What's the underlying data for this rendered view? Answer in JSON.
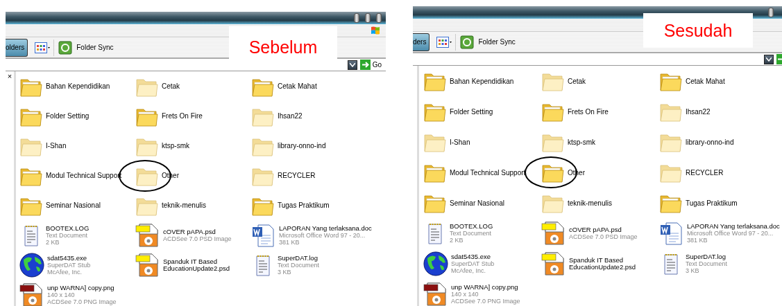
{
  "panels": [
    {
      "label": "Sebelum",
      "folders_button": "olders",
      "sync_button": "Folder Sync",
      "go_button": "Go",
      "close_mark": "×",
      "items": [
        {
          "kind": "folder",
          "name": "Bahan Kependidikan",
          "filled": true,
          "circled": false
        },
        {
          "kind": "folder",
          "name": "Cetak",
          "filled": false,
          "circled": false
        },
        {
          "kind": "folder",
          "name": "Cetak Mahat",
          "filled": true,
          "circled": false
        },
        {
          "kind": "folder",
          "name": "Folder Setting",
          "filled": true,
          "circled": false
        },
        {
          "kind": "folder",
          "name": "Frets On Fire",
          "filled": true,
          "circled": false
        },
        {
          "kind": "folder",
          "name": "Ihsan22",
          "filled": false,
          "circled": false
        },
        {
          "kind": "folder",
          "name": "I-Shan",
          "filled": false,
          "circled": false
        },
        {
          "kind": "folder",
          "name": "ktsp-smk",
          "filled": false,
          "circled": false
        },
        {
          "kind": "folder",
          "name": "library-onno-ind",
          "filled": false,
          "circled": false
        },
        {
          "kind": "folder",
          "name": "Modul Technical Support",
          "filled": true,
          "circled": false
        },
        {
          "kind": "folder",
          "name": "Other",
          "filled": false,
          "circled": true
        },
        {
          "kind": "folder",
          "name": "RECYCLER",
          "filled": false,
          "circled": false
        },
        {
          "kind": "folder",
          "name": "Seminar Nasional",
          "filled": true,
          "circled": false
        },
        {
          "kind": "folder",
          "name": "teknik-menulis",
          "filled": false,
          "circled": false
        },
        {
          "kind": "folder",
          "name": "Tugas Praktikum",
          "filled": true,
          "circled": false
        },
        {
          "kind": "text",
          "name": "BOOTEX.LOG",
          "details": [
            "Text Document",
            "2 KB"
          ]
        },
        {
          "kind": "psd",
          "name": "cOVER pAPA.psd",
          "details": [
            "ACDSee 7.0 PSD Image"
          ]
        },
        {
          "kind": "word",
          "name": "LAPORAN Yang terlaksana.doc",
          "details": [
            "Microsoft Office Word 97 - 20...",
            "381 KB"
          ]
        },
        {
          "kind": "exe",
          "name": "sdat5435.exe",
          "details": [
            "SuperDAT Stub",
            "McAfee, Inc."
          ]
        },
        {
          "kind": "psd",
          "name": "Spanduk IT Based EducationUpdate2.psd"
        },
        {
          "kind": "text",
          "name": "SuperDAT.log",
          "details": [
            "Text Document",
            "3 KB"
          ]
        },
        {
          "kind": "png",
          "name": "unp WARNA] copy.png",
          "details": [
            "140 x 140",
            "ACDSee 7.0 PNG Image"
          ]
        }
      ]
    },
    {
      "label": "Sesudah",
      "folders_button": "ders",
      "sync_button": "Folder Sync",
      "items": [
        {
          "kind": "folder",
          "name": "Bahan Kependidikan",
          "filled": true,
          "circled": false
        },
        {
          "kind": "folder",
          "name": "Cetak",
          "filled": false,
          "circled": false
        },
        {
          "kind": "folder",
          "name": "Cetak Mahat",
          "filled": true,
          "circled": false
        },
        {
          "kind": "folder",
          "name": "Folder Setting",
          "filled": true,
          "circled": false
        },
        {
          "kind": "folder",
          "name": "Frets On Fire",
          "filled": true,
          "circled": false
        },
        {
          "kind": "folder",
          "name": "Ihsan22",
          "filled": false,
          "circled": false
        },
        {
          "kind": "folder",
          "name": "I-Shan",
          "filled": false,
          "circled": false
        },
        {
          "kind": "folder",
          "name": "ktsp-smk",
          "filled": false,
          "circled": false
        },
        {
          "kind": "folder",
          "name": "library-onno-ind",
          "filled": false,
          "circled": false
        },
        {
          "kind": "folder",
          "name": "Modul Technical Support",
          "filled": true,
          "circled": false
        },
        {
          "kind": "folder",
          "name": "Other",
          "filled": true,
          "circled": true
        },
        {
          "kind": "folder",
          "name": "RECYCLER",
          "filled": false,
          "circled": false
        },
        {
          "kind": "folder",
          "name": "Seminar Nasional",
          "filled": true,
          "circled": false
        },
        {
          "kind": "folder",
          "name": "teknik-menulis",
          "filled": false,
          "circled": false
        },
        {
          "kind": "folder",
          "name": "Tugas Praktikum",
          "filled": true,
          "circled": false
        },
        {
          "kind": "text",
          "name": "BOOTEX.LOG",
          "details": [
            "Text Document",
            "2 KB"
          ]
        },
        {
          "kind": "psd",
          "name": "cOVER pAPA.psd",
          "details": [
            "ACDSee 7.0 PSD Image"
          ]
        },
        {
          "kind": "word",
          "name": "LAPORAN Yang terlaksana.doc",
          "details": [
            "Microsoft Office Word 97 - 20...",
            "381 KB"
          ]
        },
        {
          "kind": "exe",
          "name": "sdat5435.exe",
          "details": [
            "SuperDAT Stub",
            "McAfee, Inc."
          ]
        },
        {
          "kind": "psd",
          "name": "Spanduk IT Based EducationUpdate2.psd"
        },
        {
          "kind": "text",
          "name": "SuperDAT.log",
          "details": [
            "Text Document",
            "3 KB"
          ]
        },
        {
          "kind": "png",
          "name": "unp WARNA] copy.png",
          "details": [
            "140 x 140",
            "ACDSee 7.0 PNG Image"
          ]
        }
      ]
    }
  ]
}
